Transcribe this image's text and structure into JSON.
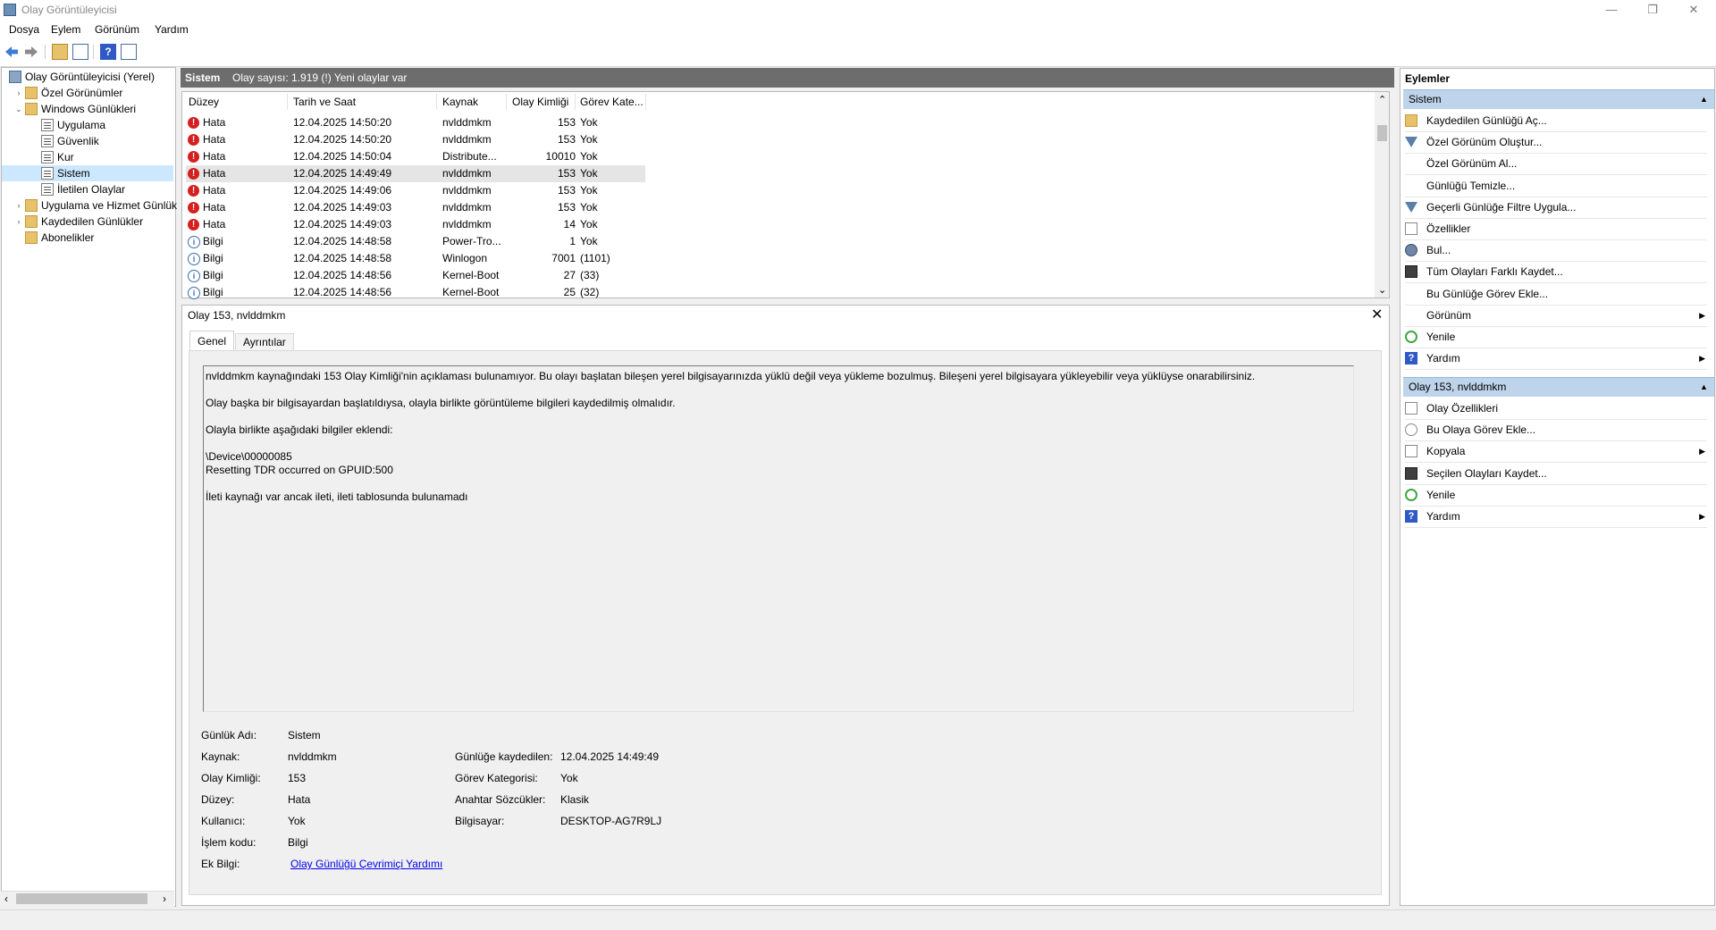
{
  "window": {
    "title": "Olay Görüntüleyicisi",
    "controls": {
      "minimize": "—",
      "maximize": "❐",
      "close": "✕"
    }
  },
  "menu": [
    "Dosya",
    "Eylem",
    "Görünüm",
    "Yardım"
  ],
  "toolbar": [
    "back-arrow-icon",
    "forward-arrow-icon",
    "open-folder-icon",
    "show-hide-pane-icon",
    "help-icon",
    "properties-pane-icon"
  ],
  "tree": [
    {
      "label": "Olay Görüntüleyicisi (Yerel)",
      "level": 0,
      "icon": "root",
      "expander": ""
    },
    {
      "label": "Özel Görünümler",
      "level": 1,
      "icon": "folder",
      "expander": "›"
    },
    {
      "label": "Windows Günlükleri",
      "level": 1,
      "icon": "folder",
      "expander": "⌄"
    },
    {
      "label": "Uygulama",
      "level": 2,
      "icon": "log",
      "expander": ""
    },
    {
      "label": "Güvenlik",
      "level": 2,
      "icon": "log",
      "expander": ""
    },
    {
      "label": "Kur",
      "level": 2,
      "icon": "log",
      "expander": ""
    },
    {
      "label": "Sistem",
      "level": 2,
      "icon": "log",
      "expander": "",
      "selected": true
    },
    {
      "label": "İletilen Olaylar",
      "level": 2,
      "icon": "log",
      "expander": ""
    },
    {
      "label": "Uygulama ve Hizmet Günlük",
      "level": 1,
      "icon": "folder",
      "expander": "›"
    },
    {
      "label": "Kaydedilen Günlükler",
      "level": 1,
      "icon": "folder",
      "expander": "›"
    },
    {
      "label": "Abonelikler",
      "level": 1,
      "icon": "folder",
      "expander": ""
    }
  ],
  "tree_scroll": {
    "left": "‹",
    "right": "›"
  },
  "center_header": {
    "title": "Sistem",
    "info": "Olay sayısı: 1.919 (!) Yeni olaylar var"
  },
  "columns": [
    "Düzey",
    "Tarih ve Saat",
    "Kaynak",
    "Olay Kimliği",
    "Görev Kate..."
  ],
  "events": [
    {
      "level": "Hata",
      "date": "12.04.2025 14:50:20",
      "source": "nvlddmkm",
      "id": "153",
      "task": "Yok"
    },
    {
      "level": "Hata",
      "date": "12.04.2025 14:50:20",
      "source": "nvlddmkm",
      "id": "153",
      "task": "Yok"
    },
    {
      "level": "Hata",
      "date": "12.04.2025 14:50:04",
      "source": "Distribute...",
      "id": "10010",
      "task": "Yok"
    },
    {
      "level": "Hata",
      "date": "12.04.2025 14:49:49",
      "source": "nvlddmkm",
      "id": "153",
      "task": "Yok",
      "selected": true
    },
    {
      "level": "Hata",
      "date": "12.04.2025 14:49:06",
      "source": "nvlddmkm",
      "id": "153",
      "task": "Yok"
    },
    {
      "level": "Hata",
      "date": "12.04.2025 14:49:03",
      "source": "nvlddmkm",
      "id": "153",
      "task": "Yok"
    },
    {
      "level": "Hata",
      "date": "12.04.2025 14:49:03",
      "source": "nvlddmkm",
      "id": "14",
      "task": "Yok"
    },
    {
      "level": "Bilgi",
      "date": "12.04.2025 14:48:58",
      "source": "Power-Tro...",
      "id": "1",
      "task": "Yok"
    },
    {
      "level": "Bilgi",
      "date": "12.04.2025 14:48:58",
      "source": "Winlogon",
      "id": "7001",
      "task": "(1101)"
    },
    {
      "level": "Bilgi",
      "date": "12.04.2025 14:48:56",
      "source": "Kernel-Boot",
      "id": "27",
      "task": "(33)"
    },
    {
      "level": "Bilgi",
      "date": "12.04.2025 14:48:56",
      "source": "Kernel-Boot",
      "id": "25",
      "task": "(32)"
    }
  ],
  "list_scroll": {
    "up": "⌃",
    "down": "⌄"
  },
  "detail": {
    "title": "Olay 153, nvlddmkm",
    "close": "✕",
    "tabs": [
      "Genel",
      "Ayrıntılar"
    ],
    "description_lines": [
      "nvlddmkm kaynağındaki 153 Olay Kimliği'nin açıklaması bulunamıyor. Bu olayı başlatan bileşen yerel bilgisayarınızda yüklü değil veya yükleme bozulmuş. Bileşeni yerel bilgisayara yükleyebilir veya yüklüyse onarabilirsiniz.",
      "Olay başka bir bilgisayardan başlatıldıysa, olayla birlikte görüntüleme bilgileri kaydedilmiş olmalıdır.",
      "Olayla birlikte aşağıdaki bilgiler eklendi:",
      "\\Device\\00000085",
      "Resetting TDR occurred on GPUID:500",
      "İleti kaynağı var ancak ileti, ileti tablosunda bulunamadı"
    ],
    "props": {
      "log_name_label": "Günlük Adı:",
      "log_name": "Sistem",
      "source_label": "Kaynak:",
      "source": "nvlddmkm",
      "logged_label": "Günlüğe kaydedilen:",
      "logged": "12.04.2025 14:49:49",
      "event_id_label": "Olay Kimliği:",
      "event_id": "153",
      "task_label": "Görev Kategorisi:",
      "task": "Yok",
      "level_label": "Düzey:",
      "level": "Hata",
      "keywords_label": "Anahtar Sözcükler:",
      "keywords": "Klasik",
      "user_label": "Kullanıcı:",
      "user": "Yok",
      "computer_label": "Bilgisayar:",
      "computer": "DESKTOP-AG7R9LJ",
      "opcode_label": "İşlem kodu:",
      "opcode": "Bilgi",
      "more_info_label": "Ek Bilgi:",
      "more_info_link": "Olay Günlüğü Çevrimiçi Yardımı"
    }
  },
  "actions": {
    "title": "Eylemler",
    "section1": {
      "title": "Sistem",
      "items": [
        {
          "label": "Kaydedilen Günlüğü Aç...",
          "icon": "open"
        },
        {
          "label": "Özel Görünüm Oluştur...",
          "icon": "filter"
        },
        {
          "label": "Özel Görünüm Al...",
          "icon": ""
        },
        {
          "label": "Günlüğü Temizle...",
          "icon": ""
        },
        {
          "label": "Geçerli Günlüğe Filtre Uygula...",
          "icon": "filter"
        },
        {
          "label": "Özellikler",
          "icon": "doc"
        },
        {
          "label": "Bul...",
          "icon": "find"
        },
        {
          "label": "Tüm Olayları Farklı Kaydet...",
          "icon": "save"
        },
        {
          "label": "Bu Günlüğe Görev Ekle...",
          "icon": ""
        },
        {
          "label": "Görünüm",
          "icon": "",
          "submenu": true
        },
        {
          "label": "Yenile",
          "icon": "refresh"
        },
        {
          "label": "Yardım",
          "icon": "help",
          "submenu": true
        }
      ]
    },
    "section2": {
      "title": "Olay 153, nvlddmkm",
      "items": [
        {
          "label": "Olay Özellikleri",
          "icon": "doc"
        },
        {
          "label": "Bu Olaya Görev Ekle...",
          "icon": "task"
        },
        {
          "label": "Kopyala",
          "icon": "doc",
          "submenu": true
        },
        {
          "label": "Seçilen Olayları Kaydet...",
          "icon": "save"
        },
        {
          "label": "Yenile",
          "icon": "refresh"
        },
        {
          "label": "Yardım",
          "icon": "help",
          "submenu": true
        }
      ]
    },
    "collapse_glyph": "▲",
    "submenu_glyph": "▶"
  }
}
